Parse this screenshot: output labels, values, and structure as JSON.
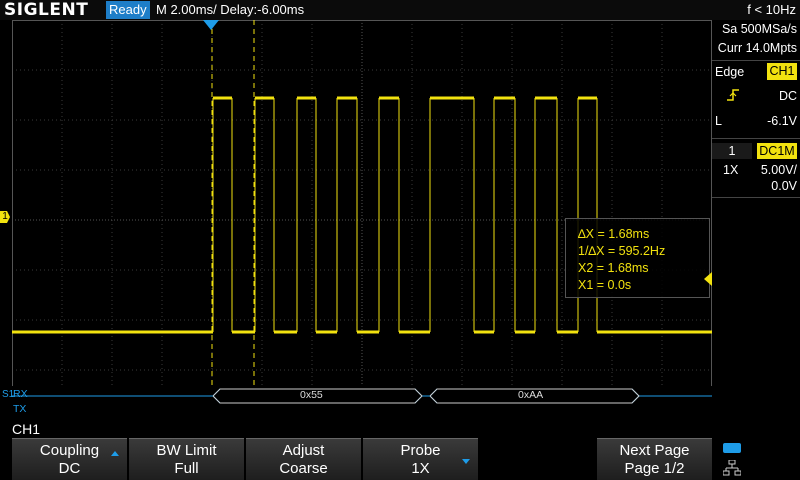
{
  "header": {
    "logo": "SIGLENT",
    "status": "Ready",
    "timebase": "M 2.00ms/ Delay:-6.00ms",
    "trigger_freq": "f < 10Hz"
  },
  "acquisition": {
    "sample_rate": "Sa 500MSa/s",
    "memory_depth": "Curr 14.0Mpts"
  },
  "trigger": {
    "type": "Edge",
    "source": "CH1",
    "slope_icon": "rising-edge-icon",
    "coupling": "DC",
    "level_label": "L",
    "level": "-6.1V"
  },
  "channel": {
    "number": "1",
    "mode": "DC1M",
    "probe": "1X",
    "scale": "5.00V/",
    "offset": "0.0V",
    "marker": "1"
  },
  "cursors": {
    "delta_x": "∆X = 1.68ms",
    "inv_delta_x": "1/∆X = 595.2Hz",
    "x2": "X2 = 1.68ms",
    "x1": "X1 = 0.0s"
  },
  "decode": {
    "bus_marker": "S1",
    "rx_label": "RX",
    "tx_label": "TX",
    "frames": [
      "0x55",
      "0xAA"
    ]
  },
  "menu": {
    "title": "CH1",
    "buttons": [
      {
        "line1": "Coupling",
        "line2": "DC"
      },
      {
        "line1": "BW Limit",
        "line2": "Full"
      },
      {
        "line1": "Adjust",
        "line2": "Coarse"
      },
      {
        "line1": "Probe",
        "line2": "1X"
      },
      {
        "line1": "Next Page",
        "line2": "Page 1/2"
      }
    ]
  },
  "colors": {
    "channel1": "#f2e20f",
    "accent": "#1e9ce8",
    "status_bg": "#1e7ec8"
  }
}
